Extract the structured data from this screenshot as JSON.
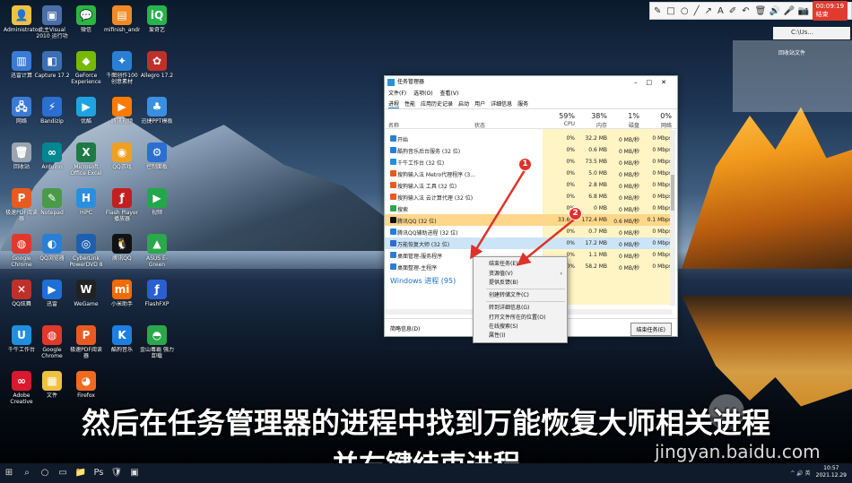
{
  "desktop_icons": [
    {
      "label": "Administrator",
      "color": "#f0c040",
      "glyph": "👤"
    },
    {
      "label": "此主Visual 2010 运行功能",
      "color": "#4a6ea8",
      "glyph": "▣"
    },
    {
      "label": "微信",
      "color": "#2bb640",
      "glyph": "💬"
    },
    {
      "label": "mifinish_android",
      "color": "#f08a24",
      "glyph": "▤"
    },
    {
      "label": "爱奇艺",
      "color": "#27b34d",
      "glyph": "iQ"
    },
    {
      "label": "迅雷计算",
      "color": "#3a7bd5",
      "glyph": "▥"
    },
    {
      "label": "Capture 17.2",
      "color": "#3a6fb3",
      "glyph": "◧"
    },
    {
      "label": "GeForce Experience",
      "color": "#76b900",
      "glyph": "◆"
    },
    {
      "label": "千图创作100 创意素材",
      "color": "#2a7fd4",
      "glyph": "✦"
    },
    {
      "label": "Allegro 17.2",
      "color": "#c0302a",
      "glyph": "✿"
    },
    {
      "label": "网络",
      "color": "#3a7bd5",
      "glyph": "🖧"
    },
    {
      "label": "Bandizip",
      "color": "#2a6fd1",
      "glyph": "⚡"
    },
    {
      "label": "优酷",
      "color": "#1fa3e0",
      "glyph": "▶"
    },
    {
      "label": "腾讯视频",
      "color": "#ff7a00",
      "glyph": "▶"
    },
    {
      "label": "迅捷PPT模板",
      "color": "#3a8fe0",
      "glyph": "♣"
    },
    {
      "label": "回收站",
      "color": "#9aa5b1",
      "glyph": "🗑"
    },
    {
      "label": "Arduino",
      "color": "#00878f",
      "glyph": "∞"
    },
    {
      "label": "Microsoft Office Excel 2",
      "color": "#1d7a45",
      "glyph": "X"
    },
    {
      "label": "QQ游戏",
      "color": "#f0a020",
      "glyph": "◉"
    },
    {
      "label": "控制面板",
      "color": "#2a6fd1",
      "glyph": "⚙"
    },
    {
      "label": "极速PDF阅读器",
      "color": "#e85a20",
      "glyph": "P"
    },
    {
      "label": "Notepad",
      "color": "#4a9a4a",
      "glyph": "✎"
    },
    {
      "label": "HiPC",
      "color": "#2a8fe0",
      "glyph": "H"
    },
    {
      "label": "Flash Player 播放器",
      "color": "#c21f1f",
      "glyph": "ƒ"
    },
    {
      "label": "视频",
      "color": "#22a84a",
      "glyph": "▶"
    },
    {
      "label": "Google Chrome",
      "color": "#e0392b",
      "glyph": "◍"
    },
    {
      "label": "QQ浏览器",
      "color": "#2a7fd4",
      "glyph": "◐"
    },
    {
      "label": "CyberLink PowerDVD 8",
      "color": "#1f5fb0",
      "glyph": "◎"
    },
    {
      "label": "腾讯QQ",
      "color": "#111",
      "glyph": "🐧"
    },
    {
      "label": "ASUS E-Green",
      "color": "#2aa84a",
      "glyph": "▲"
    },
    {
      "label": "QQ炫舞",
      "color": "#c0302a",
      "glyph": "✕"
    },
    {
      "label": "迅雷",
      "color": "#1f6fd4",
      "glyph": "▶"
    },
    {
      "label": "WeGame",
      "color": "#222",
      "glyph": "W"
    },
    {
      "label": "小米助手",
      "color": "#f46a00",
      "glyph": "mi"
    },
    {
      "label": "FlashFXP",
      "color": "#2a5fd0",
      "glyph": "ƒ"
    },
    {
      "label": "千牛工作台",
      "color": "#1f8fe0",
      "glyph": "U"
    },
    {
      "label": "Google Chrome",
      "color": "#e0392b",
      "glyph": "◍"
    },
    {
      "label": "极速PDF阅读器",
      "color": "#e85a20",
      "glyph": "P"
    },
    {
      "label": "酷狗音乐",
      "color": "#1f7fe0",
      "glyph": "K"
    },
    {
      "label": "金山毒霸 强力卸载",
      "color": "#2aa84a",
      "glyph": "◓"
    },
    {
      "label": "Adobe Creative Cloud",
      "color": "#d8192e",
      "glyph": "∞"
    },
    {
      "label": "文件",
      "color": "#f0c040",
      "glyph": "▦"
    },
    {
      "label": "Firefox",
      "color": "#f06a1f",
      "glyph": "◕"
    }
  ],
  "toolbar": {
    "icons": [
      "pencil-icon",
      "rect-icon",
      "circle-icon",
      "line-icon",
      "arrow-icon",
      "text-icon",
      "highlight-icon",
      "undo-icon",
      "delete-icon",
      "volume-icon",
      "mic-icon",
      "camera-icon"
    ],
    "glyphs": [
      "✎",
      "□",
      "○",
      "╱",
      "↗",
      "A",
      "✐",
      "↶",
      "🗑",
      "🔊",
      "🎤",
      "📷"
    ],
    "record_label": "00:09:19 结束"
  },
  "folder_bar": "C:\\Us...",
  "panel_caption": "回收站文件",
  "task_manager": {
    "title": "任务管理器",
    "menu": [
      "文件(F)",
      "选项(O)",
      "查看(V)"
    ],
    "tabs": [
      "进程",
      "性能",
      "应用历史记录",
      "启动",
      "用户",
      "详细信息",
      "服务"
    ],
    "columns": {
      "name": "名称",
      "status": "状态",
      "cpu_pct": "59%",
      "cpu": "CPU",
      "mem_pct": "38%",
      "mem": "内存",
      "disk_pct": "1%",
      "disk": "磁盘",
      "net_pct": "0%",
      "net": "网络"
    },
    "rows": [
      {
        "name": "开始",
        "cpu": "0%",
        "mem": "32.2 MB",
        "disk": "0 MB/秒",
        "net": "0 Mbps",
        "color": "#2a7fd4"
      },
      {
        "name": "酷狗音乐后台服务 (32 位)",
        "cpu": "0%",
        "mem": "0.6 MB",
        "disk": "0 MB/秒",
        "net": "0 Mbps",
        "color": "#1f7fe0"
      },
      {
        "name": "千牛工作台 (32 位)",
        "cpu": "0%",
        "mem": "73.5 MB",
        "disk": "0 MB/秒",
        "net": "0 Mbps",
        "color": "#1f8fe0"
      },
      {
        "name": "搜狗输入法 Metro代理程序 (3...",
        "cpu": "0%",
        "mem": "5.0 MB",
        "disk": "0 MB/秒",
        "net": "0 Mbps",
        "color": "#e85a20"
      },
      {
        "name": "搜狗输入法 工具 (32 位)",
        "cpu": "0%",
        "mem": "2.8 MB",
        "disk": "0 MB/秒",
        "net": "0 Mbps",
        "color": "#e85a20"
      },
      {
        "name": "搜狗输入法 云计算代理 (32 位)",
        "cpu": "0%",
        "mem": "6.8 MB",
        "disk": "0 MB/秒",
        "net": "0 Mbps",
        "color": "#e85a20"
      },
      {
        "name": "搜索",
        "cpu": "0%",
        "mem": "0 MB",
        "disk": "0 MB/秒",
        "net": "0 Mbps",
        "color": "#2aa84a"
      },
      {
        "name": "腾讯QQ (32 位)",
        "cpu": "33.6%",
        "mem": "172.4 MB",
        "disk": "0.6 MB/秒",
        "net": "0.1 Mbps",
        "color": "#111"
      },
      {
        "name": "腾讯QQ辅助进程 (32 位)",
        "cpu": "0%",
        "mem": "0.7 MB",
        "disk": "0 MB/秒",
        "net": "0 Mbps",
        "color": "#1f7fe0"
      },
      {
        "name": "万能恢复大师 (32 位)",
        "cpu": "0%",
        "mem": "17.2 MB",
        "disk": "0 MB/秒",
        "net": "0 Mbps",
        "color": "#2a6fd1"
      },
      {
        "name": "桌面管理-服务程序",
        "cpu": "0%",
        "mem": "1.1 MB",
        "disk": "0 MB/秒",
        "net": "0 Mbps",
        "color": "#2a7fd4"
      },
      {
        "name": "桌面整理-主程序",
        "cpu": "0%",
        "mem": "58.2 MB",
        "disk": "0 MB/秒",
        "net": "0 Mbps",
        "color": "#2a7fd4"
      }
    ],
    "group_label": "Windows 进程 (95)",
    "footer_less": "简略信息(D)",
    "footer_end": "结束任务(E)"
  },
  "context_menu": {
    "items": [
      {
        "label": "结束任务(E)"
      },
      {
        "label": "资源值(V)",
        "arrow": "›"
      },
      {
        "label": "提供反馈(B)"
      },
      {
        "label": "创建转储文件(C)"
      },
      {
        "label": "转到详细信息(G)"
      },
      {
        "label": "打开文件所在的位置(O)"
      },
      {
        "label": "在线搜索(S)"
      },
      {
        "label": "属性(I)"
      }
    ]
  },
  "annotations": {
    "badge1": "1",
    "badge2": "2"
  },
  "subtitle": {
    "line1": "然后在任务管理器的进程中找到万能恢复大师相关进程",
    "line2": "并右键结束进程"
  },
  "watermark": "jingyan.baidu.com",
  "taskbar": {
    "glyphs": [
      "⊞",
      "⌕",
      "○",
      "▭",
      "📁",
      "Ps",
      "🛡",
      "▣"
    ],
    "tray": "^ 🔊 英",
    "time": "10:57",
    "date": "2021.12.29"
  }
}
